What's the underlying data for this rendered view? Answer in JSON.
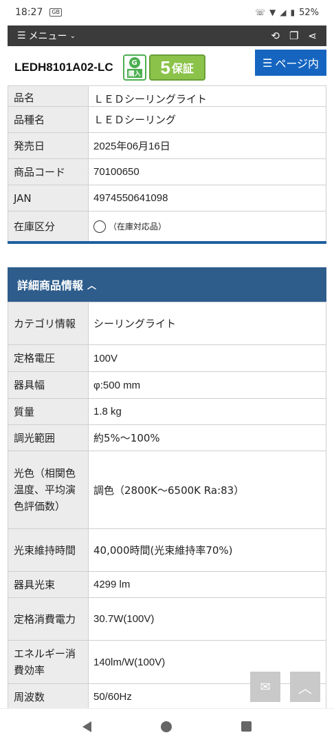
{
  "status": {
    "time": "18:27",
    "gb_label": "GB",
    "battery": "52%"
  },
  "menubar": {
    "menu_label": "メニュー"
  },
  "product": {
    "code": "LEDH8101A02-LC",
    "badge_g_letter": "G",
    "badge_g_label": "購入",
    "badge_warranty_num": "5",
    "badge_warranty_label": "保証",
    "page_button": "ページ内"
  },
  "basic_rows": [
    {
      "label": "品名",
      "value": "ＬＥＤシーリングライト"
    },
    {
      "label": "品種名",
      "value": "ＬＥＤシーリング"
    },
    {
      "label": "発売日",
      "value": "2025年06月16日"
    },
    {
      "label": "商品コード",
      "value": "70100650"
    },
    {
      "label": "JAN",
      "value": "4974550641098"
    },
    {
      "label": "在庫区分",
      "value": "（在庫対応品）"
    }
  ],
  "detail_section": {
    "title": "詳細商品情報"
  },
  "detail_rows": [
    {
      "label": "カテゴリ情報",
      "value": "シーリングライト"
    },
    {
      "label": "定格電圧",
      "value": "100V"
    },
    {
      "label": "器具幅",
      "value": "φ:500 mm"
    },
    {
      "label": "質量",
      "value": "1.8 kg"
    },
    {
      "label": "調光範囲",
      "value": "約5%～100%"
    },
    {
      "label": "光色（相関色温度、平均演色評価数）",
      "value": "調色（2800K～6500K Ra:83）"
    },
    {
      "label": "光束維持時間",
      "value": "40,000時間(光束維持率70%)"
    },
    {
      "label": "器具光束",
      "value": "4299 lm"
    },
    {
      "label": "定格消費電力",
      "value": "30.7W(100V)"
    },
    {
      "label": "エネルギー消費効率",
      "value": "140lm/W(100V)"
    },
    {
      "label": "周波数",
      "value": "50/60Hz"
    }
  ]
}
